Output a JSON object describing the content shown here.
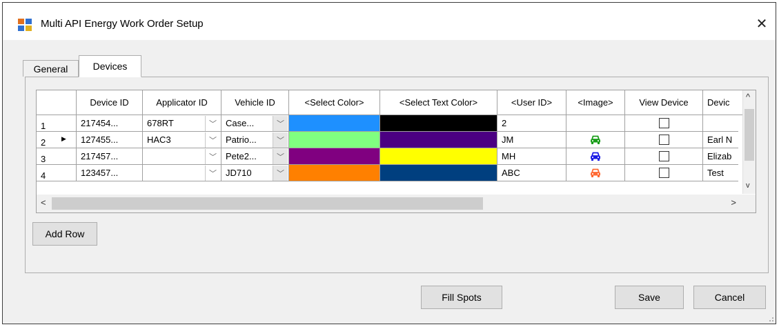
{
  "window": {
    "title": "Multi API Energy Work Order Setup",
    "close_label": "✕"
  },
  "tabs": [
    {
      "label": "General",
      "active": false
    },
    {
      "label": "Devices",
      "active": true
    }
  ],
  "grid": {
    "columns": [
      "Device ID",
      "Applicator ID",
      "Vehicle ID",
      "<Select Color>",
      "<Select Text Color>",
      "<User ID>",
      "<Image>",
      "View Device",
      "Devic"
    ],
    "rows": [
      {
        "num": "1",
        "current": false,
        "device_id": "217454...",
        "applicator_id": "678RT",
        "vehicle_id": "Case...",
        "select_color": "#1e90ff",
        "text_color": "#000000",
        "user_id": "2",
        "image_icon": "",
        "image_color": "",
        "view_device": false,
        "device": ""
      },
      {
        "num": "2",
        "current": true,
        "device_id": "127455...",
        "applicator_id": "HAC3",
        "vehicle_id": "Patrio...",
        "select_color": "#80ff80",
        "text_color": "#4b0082",
        "user_id": "JM",
        "image_icon": "car-icon",
        "image_color": "#1a9e1a",
        "view_device": false,
        "device": "Earl N"
      },
      {
        "num": "3",
        "current": false,
        "device_id": "217457...",
        "applicator_id": "",
        "vehicle_id": "Pete2...",
        "select_color": "#800080",
        "text_color": "#ffff00",
        "user_id": "MH",
        "image_icon": "car-icon",
        "image_color": "#1b1be6",
        "view_device": false,
        "device": "Elizab"
      },
      {
        "num": "4",
        "current": false,
        "device_id": "123457...",
        "applicator_id": "",
        "vehicle_id": "JD710",
        "select_color": "#ff8000",
        "text_color": "#003f7f",
        "user_id": "ABC",
        "image_icon": "car-icon",
        "image_color": "#ff6a33",
        "view_device": false,
        "device": "Test"
      }
    ]
  },
  "buttons": {
    "add_row": "Add Row",
    "fill_spots": "Fill Spots",
    "save": "Save",
    "cancel": "Cancel"
  },
  "scroll_glyphs": {
    "up": "^",
    "down": "v",
    "left": "<",
    "right": ">"
  }
}
